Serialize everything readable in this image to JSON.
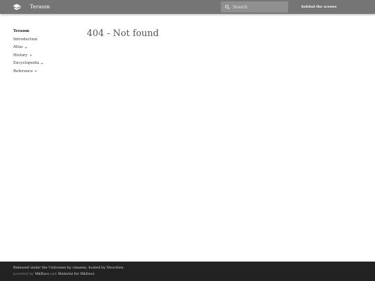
{
  "header": {
    "site_title": "Teraum",
    "search_placeholder": "Search",
    "link_label": "behind the scenes",
    "logo_icon": "mortarboard-icon",
    "search_icon": "magnifier-icon"
  },
  "sidebar": {
    "title": "Teraum",
    "items": [
      {
        "label": "Introduction",
        "expandable": false
      },
      {
        "label": "Atlas",
        "expandable": true
      },
      {
        "label": "History",
        "expandable": true
      },
      {
        "label": "Encyclopedia",
        "expandable": true
      },
      {
        "label": "Reference",
        "expandable": true
      }
    ]
  },
  "main": {
    "title": "404 - Not found"
  },
  "footer": {
    "line1": "Released under the Unlicense by cmaenn, hosted by Neocities.",
    "powered_prefix": "powered by",
    "mkdocs_link": "MkDocs",
    "and_text": "and",
    "material_link": "Material for MkDocs"
  },
  "colors": {
    "header_bg": "#757575",
    "search_bg": "#8f8f8f",
    "footer_bg": "#222222"
  }
}
